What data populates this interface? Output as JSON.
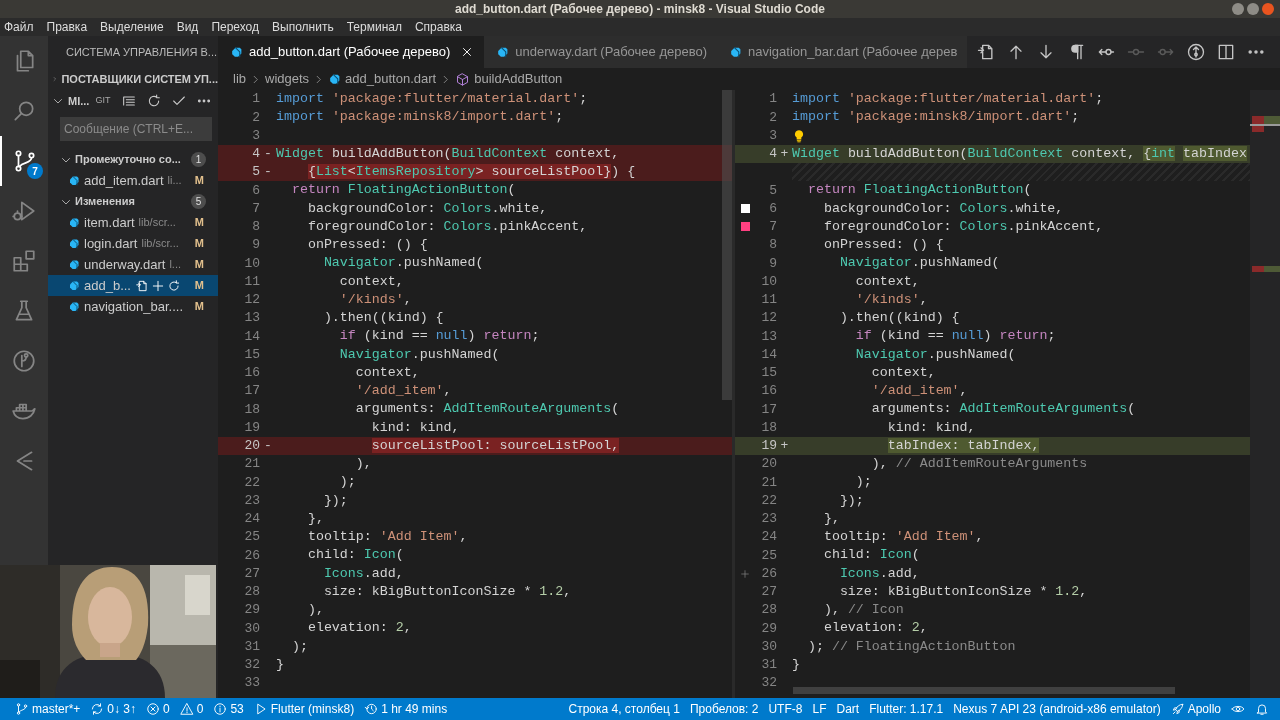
{
  "window": {
    "title": "add_button.dart (Рабочее дерево) - minsk8 - Visual Studio Code"
  },
  "menu": [
    "Файл",
    "Правка",
    "Выделение",
    "Вид",
    "Переход",
    "Выполнить",
    "Терминал",
    "Справка"
  ],
  "activity_bar": [
    {
      "kind": "files",
      "selected": false
    },
    {
      "kind": "search",
      "selected": false
    },
    {
      "kind": "source-control",
      "selected": true,
      "badge": "7"
    },
    {
      "kind": "run",
      "selected": false
    },
    {
      "kind": "extensions",
      "selected": false
    },
    {
      "kind": "testing",
      "selected": false
    },
    {
      "kind": "git-graph",
      "selected": false
    },
    {
      "kind": "docker",
      "selected": false
    },
    {
      "kind": "remote",
      "selected": false
    }
  ],
  "sidebar": {
    "title": "СИСТЕМА УПРАВЛЕНИЯ В...",
    "providers": {
      "label": "ПОСТАВЩИКИ СИСТЕМ УП...",
      "expanded": false
    },
    "repo": {
      "label": "MI...",
      "tag": "GIT",
      "expanded": true
    },
    "message": {
      "placeholder": "Сообщение (CTRL+E..."
    },
    "groups": [
      {
        "label": "Промежуточно со...",
        "count": "1",
        "expanded": true,
        "files": [
          {
            "name": "add_item.dart",
            "path": "li...",
            "status": "M",
            "selected": false
          }
        ]
      },
      {
        "label": "Изменения",
        "count": "5",
        "expanded": true,
        "files": [
          {
            "name": "item.dart",
            "path": "lib/scr...",
            "status": "M",
            "selected": false
          },
          {
            "name": "login.dart",
            "path": "lib/scr...",
            "status": "M",
            "selected": false
          },
          {
            "name": "underway.dart",
            "path": "l...",
            "status": "M",
            "selected": false
          },
          {
            "name": "add_b...",
            "status": "M",
            "selected": true
          },
          {
            "name": "navigation_bar....",
            "status": "M",
            "selected": false
          }
        ]
      }
    ]
  },
  "tabs": [
    {
      "label": "add_button.dart (Рабочее дерево)",
      "selected": true
    },
    {
      "label": "underway.dart (Рабочее дерево)",
      "selected": false
    },
    {
      "label": "navigation_bar.dart (Рабочее дерев",
      "selected": false
    }
  ],
  "toolbar": [
    {
      "kind": "open-file",
      "disabled": false
    },
    {
      "kind": "up",
      "disabled": false
    },
    {
      "kind": "down",
      "disabled": false
    },
    {
      "kind": "whitespace",
      "disabled": false
    },
    {
      "kind": "revert",
      "disabled": false
    },
    {
      "kind": "stage",
      "disabled": true
    },
    {
      "kind": "next",
      "disabled": true
    },
    {
      "kind": "compare",
      "disabled": false
    },
    {
      "kind": "split",
      "disabled": false
    },
    {
      "kind": "more",
      "disabled": false
    }
  ],
  "breadcrumb": [
    {
      "kind": "folder",
      "label": "lib"
    },
    {
      "kind": "folder",
      "label": "widgets"
    },
    {
      "kind": "file",
      "label": "add_button.dart"
    },
    {
      "kind": "symbol",
      "label": "buildAddButton"
    }
  ],
  "diff_left": {
    "lines": [
      {
        "n": "1",
        "removed": false,
        "code": [
          {
            "kind": "keyword",
            "text": "import"
          },
          {
            "kind": "string",
            "text": " 'package:flutter/material.dart'"
          },
          {
            "kind": "plain",
            "text": ";"
          }
        ]
      },
      {
        "n": "2",
        "removed": false,
        "code": [
          {
            "kind": "keyword",
            "text": "import"
          },
          {
            "kind": "string",
            "text": " 'package:minsk8/import.dart'"
          },
          {
            "kind": "plain",
            "text": ";"
          }
        ]
      },
      {
        "n": "3",
        "removed": false
      },
      {
        "n": "4",
        "sign": "-",
        "removed": true,
        "code": [
          {
            "kind": "type",
            "text": "Widget"
          },
          {
            "kind": "plain",
            "text": " buildAddButton("
          },
          {
            "kind": "type",
            "text": "BuildContext"
          },
          {
            "kind": "plain",
            "text": " context,"
          }
        ]
      },
      {
        "n": "5",
        "sign": "-",
        "removed": true,
        "code": [
          {
            "kind": "plain",
            "text": "    {",
            "changed": true
          },
          {
            "kind": "type",
            "text": "List",
            "changed": true
          },
          {
            "kind": "plain",
            "text": "<",
            "changed": true
          },
          {
            "kind": "type",
            "text": "ItemsRepository",
            "changed": true
          },
          {
            "kind": "plain",
            "text": "> sourceListPool}",
            "changed": true
          },
          {
            "kind": "plain",
            "text": ") {",
            "changed": false
          }
        ]
      },
      {
        "n": "6",
        "removed": false,
        "code": [
          {
            "kind": "control",
            "text": "  return"
          },
          {
            "kind": "type",
            "text": " FloatingActionButton"
          },
          {
            "kind": "plain",
            "text": "("
          }
        ]
      },
      {
        "n": "7",
        "removed": false,
        "code": [
          {
            "kind": "plain",
            "text": "    backgroundColor: "
          },
          {
            "kind": "type",
            "text": "Colors"
          },
          {
            "kind": "plain",
            "text": ".white,"
          }
        ]
      },
      {
        "n": "8",
        "removed": false,
        "code": [
          {
            "kind": "plain",
            "text": "    foregroundColor: "
          },
          {
            "kind": "type",
            "text": "Colors"
          },
          {
            "kind": "plain",
            "text": ".pinkAccent,"
          }
        ]
      },
      {
        "n": "9",
        "removed": false,
        "code": [
          {
            "kind": "plain",
            "text": "    onPressed: () {"
          }
        ]
      },
      {
        "n": "10",
        "removed": false,
        "code": [
          {
            "kind": "type",
            "text": "      Navigator"
          },
          {
            "kind": "plain",
            "text": ".pushNamed("
          }
        ]
      },
      {
        "n": "11",
        "removed": false,
        "code": [
          {
            "kind": "plain",
            "text": "        context,"
          }
        ]
      },
      {
        "n": "12",
        "removed": false,
        "code": [
          {
            "kind": "string",
            "text": "        '/kinds'"
          },
          {
            "kind": "plain",
            "text": ","
          }
        ]
      },
      {
        "n": "13",
        "removed": false,
        "code": [
          {
            "kind": "plain",
            "text": "      ).then((kind) {"
          }
        ]
      },
      {
        "n": "14",
        "removed": false,
        "code": [
          {
            "kind": "control",
            "text": "        if"
          },
          {
            "kind": "plain",
            "text": " (kind == "
          },
          {
            "kind": "keyword",
            "text": "null"
          },
          {
            "kind": "plain",
            "text": ") "
          },
          {
            "kind": "control",
            "text": "return"
          },
          {
            "kind": "plain",
            "text": ";"
          }
        ]
      },
      {
        "n": "15",
        "removed": false,
        "code": [
          {
            "kind": "type",
            "text": "        Navigator"
          },
          {
            "kind": "plain",
            "text": ".pushNamed("
          }
        ]
      },
      {
        "n": "16",
        "removed": false,
        "code": [
          {
            "kind": "plain",
            "text": "          context,"
          }
        ]
      },
      {
        "n": "17",
        "removed": false,
        "code": [
          {
            "kind": "string",
            "text": "          '/add_item'"
          },
          {
            "kind": "plain",
            "text": ","
          }
        ]
      },
      {
        "n": "18",
        "removed": false,
        "code": [
          {
            "kind": "plain",
            "text": "          arguments: "
          },
          {
            "kind": "type",
            "text": "AddItemRouteArguments"
          },
          {
            "kind": "plain",
            "text": "("
          }
        ]
      },
      {
        "n": "19",
        "removed": false,
        "code": [
          {
            "kind": "plain",
            "text": "            kind: kind,"
          }
        ]
      },
      {
        "n": "20",
        "sign": "-",
        "removed": true,
        "code": [
          {
            "kind": "plain",
            "text": "            sourceListPool: sourceListPool,",
            "changed": true
          }
        ]
      },
      {
        "n": "21",
        "removed": false,
        "code": [
          {
            "kind": "plain",
            "text": "          ),"
          }
        ]
      },
      {
        "n": "22",
        "removed": false,
        "code": [
          {
            "kind": "plain",
            "text": "        );"
          }
        ]
      },
      {
        "n": "23",
        "removed": false,
        "code": [
          {
            "kind": "plain",
            "text": "      });"
          }
        ]
      },
      {
        "n": "24",
        "removed": false,
        "code": [
          {
            "kind": "plain",
            "text": "    },"
          }
        ]
      },
      {
        "n": "25",
        "removed": false,
        "code": [
          {
            "kind": "plain",
            "text": "    tooltip: "
          },
          {
            "kind": "string",
            "text": "'Add Item'"
          },
          {
            "kind": "plain",
            "text": ","
          }
        ]
      },
      {
        "n": "26",
        "removed": false,
        "code": [
          {
            "kind": "plain",
            "text": "    child: "
          },
          {
            "kind": "type",
            "text": "Icon"
          },
          {
            "kind": "plain",
            "text": "("
          }
        ]
      },
      {
        "n": "27",
        "removed": false,
        "code": [
          {
            "kind": "type",
            "text": "      Icons"
          },
          {
            "kind": "plain",
            "text": ".add,"
          }
        ]
      },
      {
        "n": "28",
        "removed": false,
        "code": [
          {
            "kind": "plain",
            "text": "      size: kBigButtonIconSize * "
          },
          {
            "kind": "number",
            "text": "1.2"
          },
          {
            "kind": "plain",
            "text": ","
          }
        ]
      },
      {
        "n": "29",
        "removed": false,
        "code": [
          {
            "kind": "plain",
            "text": "    ),"
          }
        ]
      },
      {
        "n": "30",
        "removed": false,
        "code": [
          {
            "kind": "plain",
            "text": "    elevation: "
          },
          {
            "kind": "number",
            "text": "2"
          },
          {
            "kind": "plain",
            "text": ","
          }
        ]
      },
      {
        "n": "31",
        "removed": false,
        "code": [
          {
            "kind": "plain",
            "text": "  );"
          }
        ]
      },
      {
        "n": "32",
        "removed": false,
        "code": [
          {
            "kind": "plain",
            "text": "}"
          }
        ]
      },
      {
        "n": "33",
        "removed": false
      }
    ]
  },
  "diff_right": {
    "lines": [
      {
        "kind": "code",
        "n": "1",
        "added": false,
        "code": [
          {
            "kind": "keyword",
            "text": "import"
          },
          {
            "kind": "string",
            "text": " 'package:flutter/material.dart'"
          },
          {
            "kind": "plain",
            "text": ";"
          }
        ]
      },
      {
        "kind": "code",
        "n": "2",
        "added": false,
        "code": [
          {
            "kind": "keyword",
            "text": "import"
          },
          {
            "kind": "string",
            "text": " 'package:minsk8/import.dart'"
          },
          {
            "kind": "plain",
            "text": ";"
          }
        ]
      },
      {
        "kind": "code",
        "n": "3",
        "added": false,
        "marker": {
          "kind": "lightbulb"
        }
      },
      {
        "kind": "code",
        "n": "4",
        "sign": "+",
        "added": true,
        "code": [
          {
            "kind": "type",
            "text": "Widget",
            "changed": false
          },
          {
            "kind": "plain",
            "text": " buildAddButton(",
            "changed": false
          },
          {
            "kind": "type",
            "text": "BuildContext",
            "changed": false
          },
          {
            "kind": "plain",
            "text": " context, ",
            "changed": false
          },
          {
            "kind": "plain",
            "text": "{",
            "changed": true
          },
          {
            "kind": "type",
            "text": "int",
            "changed": true
          },
          {
            "kind": "plain",
            "text": " tabIndex",
            "changed": true
          }
        ]
      },
      {
        "kind": "filler"
      },
      {
        "kind": "code",
        "n": "5",
        "added": false,
        "code": [
          {
            "kind": "control",
            "text": "  return"
          },
          {
            "kind": "type",
            "text": " FloatingActionButton"
          },
          {
            "kind": "plain",
            "text": "("
          }
        ]
      },
      {
        "kind": "code",
        "n": "6",
        "added": false,
        "marker": {
          "kind": "swatch",
          "color": "#ffffff"
        },
        "code": [
          {
            "kind": "plain",
            "text": "    backgroundColor: "
          },
          {
            "kind": "type",
            "text": "Colors"
          },
          {
            "kind": "plain",
            "text": ".white,"
          }
        ]
      },
      {
        "kind": "code",
        "n": "7",
        "added": false,
        "marker": {
          "kind": "swatch",
          "color": "#ff4081"
        },
        "code": [
          {
            "kind": "plain",
            "text": "    foregroundColor: "
          },
          {
            "kind": "type",
            "text": "Colors"
          },
          {
            "kind": "plain",
            "text": ".pinkAccent,"
          }
        ]
      },
      {
        "kind": "code",
        "n": "8",
        "added": false,
        "code": [
          {
            "kind": "plain",
            "text": "    onPressed: () {"
          }
        ]
      },
      {
        "kind": "code",
        "n": "9",
        "added": false,
        "code": [
          {
            "kind": "type",
            "text": "      Navigator"
          },
          {
            "kind": "plain",
            "text": ".pushNamed("
          }
        ]
      },
      {
        "kind": "code",
        "n": "10",
        "added": false,
        "code": [
          {
            "kind": "plain",
            "text": "        context,"
          }
        ]
      },
      {
        "kind": "code",
        "n": "11",
        "added": false,
        "code": [
          {
            "kind": "string",
            "text": "        '/kinds'"
          },
          {
            "kind": "plain",
            "text": ","
          }
        ]
      },
      {
        "kind": "code",
        "n": "12",
        "added": false,
        "code": [
          {
            "kind": "plain",
            "text": "      ).then((kind) {"
          }
        ]
      },
      {
        "kind": "code",
        "n": "13",
        "added": false,
        "code": [
          {
            "kind": "control",
            "text": "        if"
          },
          {
            "kind": "plain",
            "text": " (kind == "
          },
          {
            "kind": "keyword",
            "text": "null"
          },
          {
            "kind": "plain",
            "text": ") "
          },
          {
            "kind": "control",
            "text": "return"
          },
          {
            "kind": "plain",
            "text": ";"
          }
        ]
      },
      {
        "kind": "code",
        "n": "14",
        "added": false,
        "code": [
          {
            "kind": "type",
            "text": "        Navigator"
          },
          {
            "kind": "plain",
            "text": ".pushNamed("
          }
        ]
      },
      {
        "kind": "code",
        "n": "15",
        "added": false,
        "code": [
          {
            "kind": "plain",
            "text": "          context,"
          }
        ]
      },
      {
        "kind": "code",
        "n": "16",
        "added": false,
        "code": [
          {
            "kind": "string",
            "text": "          '/add_item'"
          },
          {
            "kind": "plain",
            "text": ","
          }
        ]
      },
      {
        "kind": "code",
        "n": "17",
        "added": false,
        "code": [
          {
            "kind": "plain",
            "text": "          arguments: "
          },
          {
            "kind": "type",
            "text": "AddItemRouteArguments"
          },
          {
            "kind": "plain",
            "text": "("
          }
        ]
      },
      {
        "kind": "code",
        "n": "18",
        "added": false,
        "code": [
          {
            "kind": "plain",
            "text": "            kind: kind,"
          }
        ]
      },
      {
        "kind": "code",
        "n": "19",
        "sign": "+",
        "added": true,
        "code": [
          {
            "kind": "plain",
            "text": "            tabIndex: tabIndex,",
            "changed": true
          }
        ]
      },
      {
        "kind": "code",
        "n": "20",
        "added": false,
        "code": [
          {
            "kind": "plain",
            "text": "          ), "
          },
          {
            "kind": "comment",
            "text": "// AddItemRouteArguments"
          }
        ]
      },
      {
        "kind": "code",
        "n": "21",
        "added": false,
        "code": [
          {
            "kind": "plain",
            "text": "        );"
          }
        ]
      },
      {
        "kind": "code",
        "n": "22",
        "added": false,
        "code": [
          {
            "kind": "plain",
            "text": "      });"
          }
        ]
      },
      {
        "kind": "code",
        "n": "23",
        "added": false,
        "code": [
          {
            "kind": "plain",
            "text": "    },"
          }
        ]
      },
      {
        "kind": "code",
        "n": "24",
        "added": false,
        "code": [
          {
            "kind": "plain",
            "text": "    tooltip: "
          },
          {
            "kind": "string",
            "text": "'Add Item'"
          },
          {
            "kind": "plain",
            "text": ","
          }
        ]
      },
      {
        "kind": "code",
        "n": "25",
        "added": false,
        "code": [
          {
            "kind": "plain",
            "text": "    child: "
          },
          {
            "kind": "type",
            "text": "Icon"
          },
          {
            "kind": "plain",
            "text": "("
          }
        ]
      },
      {
        "kind": "code",
        "n": "26",
        "added": false,
        "marker": {
          "kind": "plus"
        },
        "code": [
          {
            "kind": "type",
            "text": "      Icons"
          },
          {
            "kind": "plain",
            "text": ".add,"
          }
        ]
      },
      {
        "kind": "code",
        "n": "27",
        "added": false,
        "code": [
          {
            "kind": "plain",
            "text": "      size: kBigButtonIconSize * "
          },
          {
            "kind": "number",
            "text": "1.2"
          },
          {
            "kind": "plain",
            "text": ","
          }
        ]
      },
      {
        "kind": "code",
        "n": "28",
        "added": false,
        "code": [
          {
            "kind": "plain",
            "text": "    ), "
          },
          {
            "kind": "comment",
            "text": "// Icon"
          }
        ]
      },
      {
        "kind": "code",
        "n": "29",
        "added": false,
        "code": [
          {
            "kind": "plain",
            "text": "    elevation: "
          },
          {
            "kind": "number",
            "text": "2"
          },
          {
            "kind": "plain",
            "text": ","
          }
        ]
      },
      {
        "kind": "code",
        "n": "30",
        "added": false,
        "code": [
          {
            "kind": "plain",
            "text": "  ); "
          },
          {
            "kind": "comment",
            "text": "// FloatingActionButton"
          }
        ]
      },
      {
        "kind": "code",
        "n": "31",
        "added": false,
        "code": [
          {
            "kind": "plain",
            "text": "}"
          }
        ]
      },
      {
        "kind": "code",
        "n": "32",
        "added": false
      }
    ]
  },
  "webcam": {
    "kind": "picture"
  },
  "status_bar": {
    "left": [
      {
        "kind": "branch",
        "text": "master*+"
      },
      {
        "kind": "sync",
        "text": "0↓ 3↑"
      },
      {
        "kind": "error",
        "text": "0"
      },
      {
        "kind": "warning",
        "text": "0"
      },
      {
        "kind": "info",
        "text": "53"
      },
      {
        "kind": "play",
        "text": "Flutter (minsk8)"
      },
      {
        "kind": "history",
        "text": "1 hr 49 mins"
      }
    ],
    "right": [
      {
        "kind": "text",
        "text": "Строка 4, столбец 1"
      },
      {
        "kind": "text",
        "text": "Пробелов: 2"
      },
      {
        "kind": "text",
        "text": "UTF-8"
      },
      {
        "kind": "text",
        "text": "LF"
      },
      {
        "kind": "text",
        "text": "Dart"
      },
      {
        "kind": "text",
        "text": "Flutter: 1.17.1"
      },
      {
        "kind": "text",
        "text": "Nexus 7 API 23 (android-x86 emulator)"
      },
      {
        "kind": "rocket",
        "text": "Apollo"
      },
      {
        "kind": "eye"
      },
      {
        "kind": "bell"
      }
    ]
  }
}
